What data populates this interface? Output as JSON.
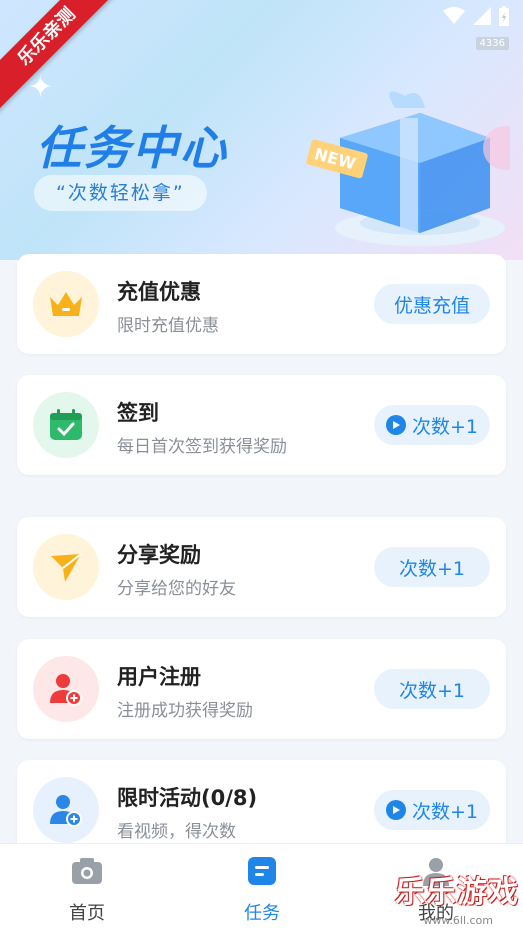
{
  "status": {
    "badge_number": "4336"
  },
  "watermark_top": "乐乐亲测",
  "header": {
    "title": "任务中心",
    "subtitle": "“次数轻松拿”",
    "gift_badge": "NEW"
  },
  "tasks": [
    {
      "name": "充值优惠",
      "desc": "限时充值优惠",
      "action": "优惠充值",
      "icon": "crown-icon",
      "icon_bg": "#fff4d9",
      "play": false
    },
    {
      "name": "签到",
      "desc": "每日首次签到获得奖励",
      "action": "次数+1",
      "icon": "calendar-check-icon",
      "icon_bg": "#e3f7ec",
      "play": true
    },
    {
      "name": "分享奖励",
      "desc": "分享给您的好友",
      "action": "次数+1",
      "icon": "paper-plane-icon",
      "icon_bg": "#fff4d9",
      "play": false
    },
    {
      "name": "用户注册",
      "desc": "注册成功获得奖励",
      "action": "次数+1",
      "icon": "user-add-icon",
      "icon_bg": "#fde7e7",
      "play": false
    },
    {
      "name": "限时活动(0/8)",
      "desc": "看视频，得次数",
      "action": "次数+1",
      "icon": "user-add-blue-icon",
      "icon_bg": "#e7f1fd",
      "play": true
    }
  ],
  "tabbar": {
    "items": [
      {
        "label": "首页",
        "icon": "camera-icon",
        "active": false
      },
      {
        "label": "任务",
        "icon": "task-icon",
        "active": true
      },
      {
        "label": "我的",
        "icon": "user-icon",
        "active": false
      }
    ]
  },
  "watermark_bottom": {
    "text": "乐乐游戏",
    "url": "www.6ll.com"
  },
  "colors": {
    "accent": "#1f86e8",
    "title_blue": "#1f7ee8"
  }
}
